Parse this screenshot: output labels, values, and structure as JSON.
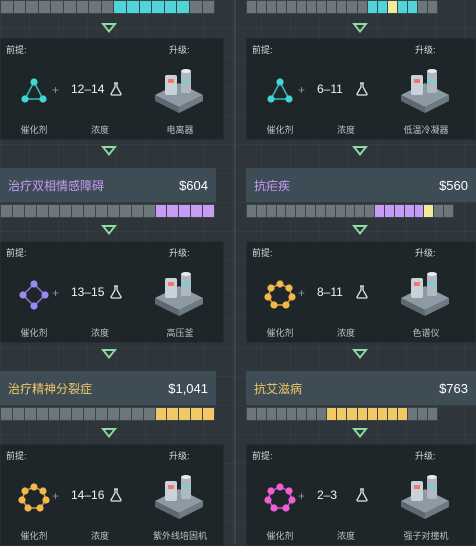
{
  "labels": {
    "prereq": "前提:",
    "upgrade": "升级:",
    "catalyst": "催化剂",
    "concentration": "浓度"
  },
  "left": {
    "top_bar": [
      "grey",
      "grey",
      "grey",
      "grey",
      "grey",
      "grey",
      "grey",
      "grey",
      "grey",
      "teal",
      "teal",
      "teal",
      "teal",
      "teal",
      "teal",
      "grey",
      "grey"
    ],
    "card1": {
      "range": "12–14",
      "machine": "电离器",
      "catalyst_color": "#3ed7d3",
      "catalyst_shape": "triangle"
    },
    "title2": {
      "name": "治疗双相情感障碍",
      "price": "$604",
      "name_color": "#c89cf4"
    },
    "bar2": [
      "grey",
      "grey",
      "grey",
      "grey",
      "grey",
      "grey",
      "grey",
      "grey",
      "grey",
      "grey",
      "grey",
      "grey",
      "grey",
      "purple",
      "purple",
      "purple",
      "purple",
      "purple"
    ],
    "card2": {
      "range": "13–15",
      "machine": "高压釜",
      "catalyst_color": "#9a8af2",
      "catalyst_shape": "diamond"
    },
    "title3": {
      "name": "治疗精神分裂症",
      "price": "$1,041",
      "name_color": "#f2c865"
    },
    "bar3": [
      "grey",
      "grey",
      "grey",
      "grey",
      "grey",
      "grey",
      "grey",
      "grey",
      "grey",
      "grey",
      "grey",
      "grey",
      "grey",
      "gold",
      "gold",
      "gold",
      "gold",
      "gold"
    ],
    "card3": {
      "range": "14–16",
      "machine": "紫外线培固机",
      "catalyst_color": "#f2b84a",
      "catalyst_shape": "ring"
    }
  },
  "right": {
    "top_bar": [
      "grey",
      "grey",
      "grey",
      "grey",
      "grey",
      "grey",
      "grey",
      "grey",
      "grey",
      "grey",
      "grey",
      "grey",
      "teal",
      "teal",
      "lite",
      "teal",
      "teal",
      "grey",
      "grey"
    ],
    "card1": {
      "range": "6–11",
      "machine": "低温冷凝器",
      "catalyst_color": "#3ed7d3",
      "catalyst_shape": "triangle"
    },
    "title2": {
      "name": "抗疟疾",
      "price": "$560",
      "name_color": "#c89cf4"
    },
    "bar2": [
      "grey",
      "grey",
      "grey",
      "grey",
      "grey",
      "grey",
      "grey",
      "grey",
      "grey",
      "grey",
      "grey",
      "grey",
      "grey",
      "purple",
      "purple",
      "purple",
      "purple",
      "purple",
      "lite",
      "grey",
      "grey"
    ],
    "card2": {
      "range": "8–11",
      "machine": "色谱仪",
      "catalyst_color": "#f2b84a",
      "catalyst_shape": "ring"
    },
    "title3": {
      "name": "抗艾滋病",
      "price": "$763",
      "name_color": "#f2c865"
    },
    "bar3": [
      "grey",
      "grey",
      "grey",
      "grey",
      "grey",
      "grey",
      "grey",
      "grey",
      "gold",
      "gold",
      "gold",
      "gold",
      "gold",
      "gold",
      "gold",
      "gold",
      "grey",
      "grey",
      "grey"
    ],
    "card3": {
      "range": "2–3",
      "machine": "强子对撞机",
      "catalyst_color": "#ee5fd8",
      "catalyst_shape": "ring"
    }
  },
  "icons": [
    "catalyst-icon",
    "flask-icon",
    "machine-icon",
    "down-arrow-icon"
  ]
}
